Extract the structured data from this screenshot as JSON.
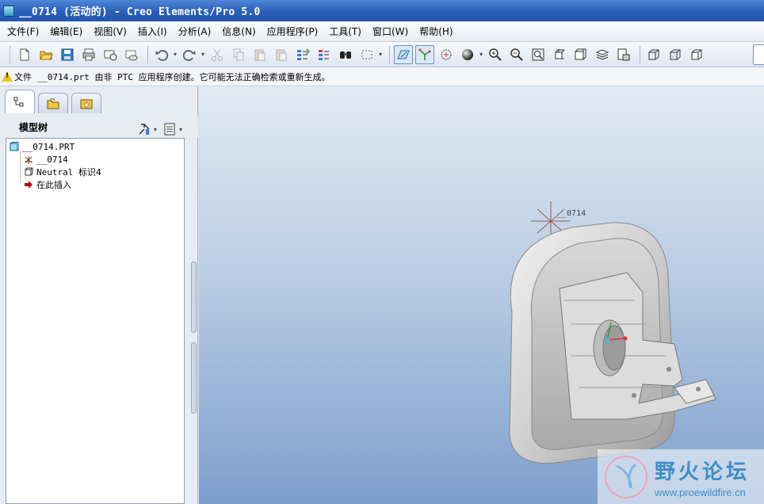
{
  "window": {
    "title": "__0714 (活动的) - Creo Elements/Pro 5.0"
  },
  "menu": {
    "items": [
      "文件(F)",
      "编辑(E)",
      "视图(V)",
      "插入(I)",
      "分析(A)",
      "信息(N)",
      "应用程序(P)",
      "工具(T)",
      "窗口(W)",
      "帮助(H)"
    ]
  },
  "toolbar": {
    "icons": [
      "new-file-icon",
      "open-folder-icon",
      "save-icon",
      "print-icon",
      "email-icon",
      "email-link-icon",
      "undo-icon",
      "redo-icon",
      "cut-icon",
      "copy-icon",
      "paste-icon",
      "paste-special-icon",
      "regenerate-icon",
      "regen-manager-icon",
      "find-icon",
      "select-box-icon",
      "datum-display-icon",
      "axis-display-icon",
      "spin-center-icon",
      "shading-icon",
      "zoom-in-icon",
      "zoom-out-icon",
      "refit-icon",
      "reorient-icon",
      "saved-views-icon",
      "layers-icon",
      "view-manager-icon",
      "wireframe-icon",
      "hidden-line-icon",
      "no-hidden-icon"
    ]
  },
  "message": {
    "text": "文件 __0714.prt 由非 PTC 应用程序创建。它可能无法正确检索或重新生成。",
    "icon": "warning-icon"
  },
  "panel": {
    "title": "模型树",
    "tabs": [
      "model-tree-tab-icon",
      "folder-browser-tab-icon",
      "favorites-tab-icon"
    ]
  },
  "tree": {
    "root": "__0714.PRT",
    "items": [
      {
        "label": "__0714",
        "icon": "coordinate-system-icon"
      },
      {
        "label": "Neutral 标识4",
        "icon": "neutral-feature-icon"
      },
      {
        "label": "在此插入",
        "icon": "insert-here-arrow-icon"
      }
    ]
  },
  "graphics": {
    "csys_label": "__0714"
  },
  "watermark": {
    "title": "野火论坛",
    "url": "www.proewildfire.cn"
  },
  "colors": {
    "title_bar": "#2a5fb8",
    "accent": "#3e8ec8",
    "warning": "#f2c21a",
    "insert_arrow": "#c00000"
  }
}
